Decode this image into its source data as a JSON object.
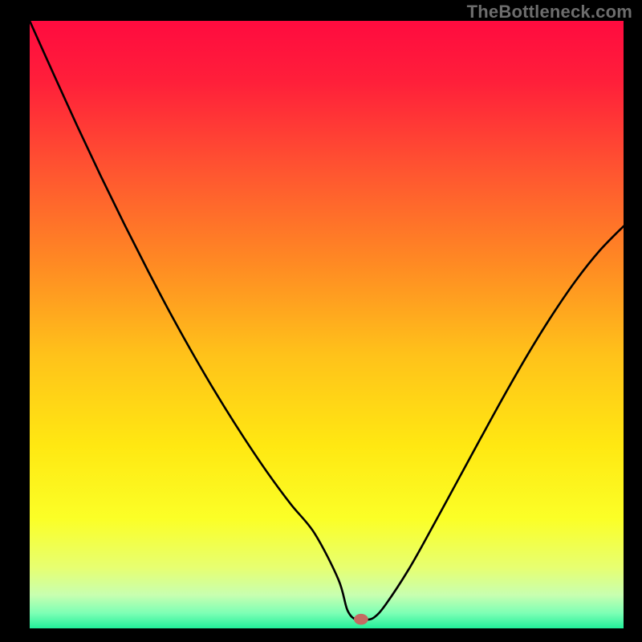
{
  "watermark": "TheBottleneck.com",
  "chart_data": {
    "type": "line",
    "title": "",
    "xlabel": "",
    "ylabel": "",
    "xlim": [
      0,
      100
    ],
    "ylim": [
      0,
      100
    ],
    "grid": false,
    "legend": false,
    "gradient_stops": [
      {
        "offset": 0.0,
        "color": "#ff0b3f"
      },
      {
        "offset": 0.1,
        "color": "#ff1f3a"
      },
      {
        "offset": 0.25,
        "color": "#ff5630"
      },
      {
        "offset": 0.4,
        "color": "#ff8a23"
      },
      {
        "offset": 0.55,
        "color": "#ffc21a"
      },
      {
        "offset": 0.7,
        "color": "#ffe812"
      },
      {
        "offset": 0.82,
        "color": "#fbff27"
      },
      {
        "offset": 0.9,
        "color": "#e7ff71"
      },
      {
        "offset": 0.945,
        "color": "#c8ffb0"
      },
      {
        "offset": 0.975,
        "color": "#7dffb5"
      },
      {
        "offset": 1.0,
        "color": "#22ef9a"
      }
    ],
    "series": [
      {
        "name": "bottleneck-curve",
        "color": "#000000",
        "x": [
          0.0,
          4.0,
          8.0,
          12.0,
          16.0,
          20.0,
          24.0,
          28.0,
          32.0,
          36.0,
          40.0,
          44.0,
          48.0,
          52.0,
          53.5,
          55.0,
          56.5,
          58.0,
          60.0,
          64.0,
          68.0,
          72.0,
          76.0,
          80.0,
          84.0,
          88.0,
          92.0,
          96.0,
          100.0
        ],
        "y": [
          100.0,
          91.3,
          82.7,
          74.4,
          66.4,
          58.7,
          51.3,
          44.3,
          37.7,
          31.5,
          25.7,
          20.4,
          15.6,
          8.0,
          3.0,
          1.4,
          1.4,
          1.8,
          4.0,
          10.0,
          17.0,
          24.2,
          31.4,
          38.5,
          45.3,
          51.6,
          57.3,
          62.2,
          66.2
        ]
      }
    ],
    "marker": {
      "name": "bottleneck-point",
      "x": 55.8,
      "y": 1.5,
      "color": "#c46a62",
      "rx": 1.2,
      "ry": 0.9
    }
  }
}
